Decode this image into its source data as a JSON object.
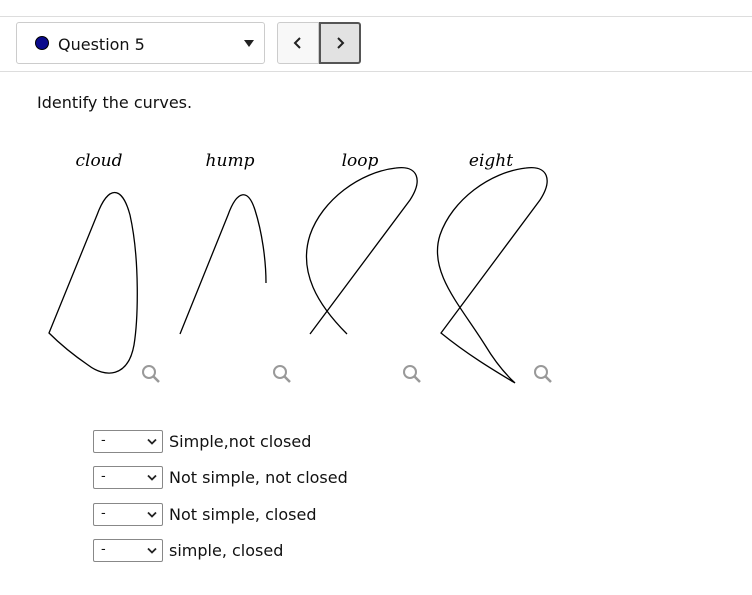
{
  "question_selector": {
    "label": "Question 5",
    "dot_color": "#0a0a8c"
  },
  "nav": {
    "prev_icon": "chevron-left-icon",
    "next_icon": "chevron-right-icon"
  },
  "prompt": "Identify the curves.",
  "figures": [
    {
      "label": "cloud"
    },
    {
      "label": "hump"
    },
    {
      "label": "loop"
    },
    {
      "label": "eight"
    }
  ],
  "answers": [
    {
      "selected": "-",
      "label": "Simple,not closed"
    },
    {
      "selected": "-",
      "label": "Not simple, not closed"
    },
    {
      "selected": "-",
      "label": "Not simple, closed"
    },
    {
      "selected": "-",
      "label": "simple, closed"
    }
  ]
}
